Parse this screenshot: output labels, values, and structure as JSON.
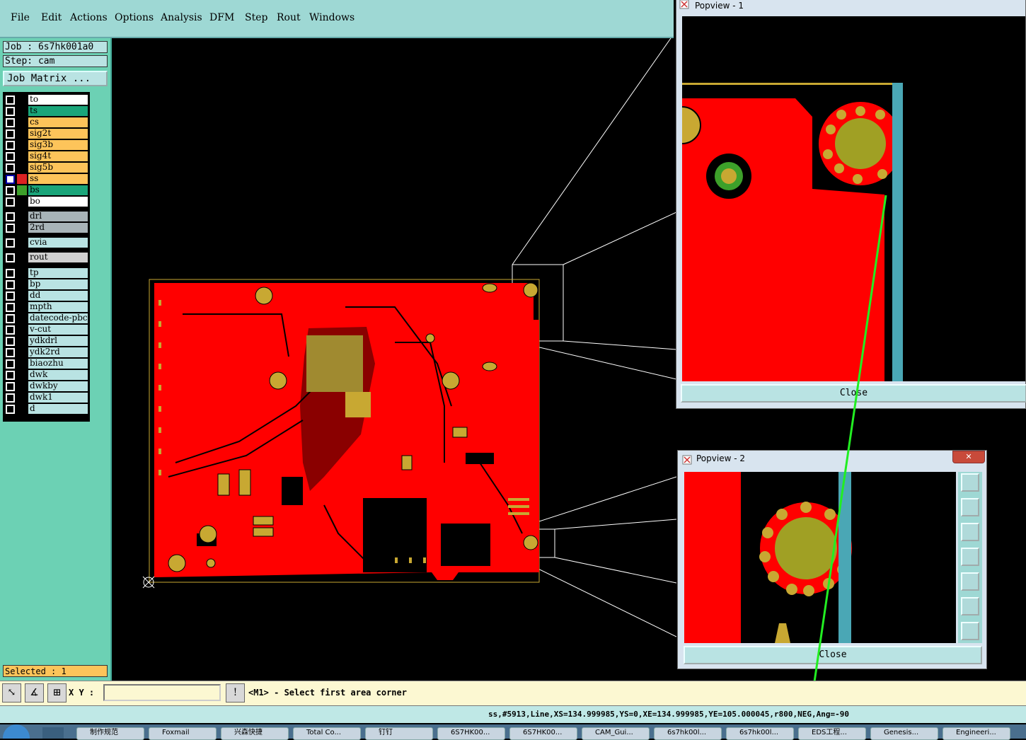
{
  "menu": [
    "File",
    "Edit",
    "Actions",
    "Options",
    "Analysis",
    "DFM",
    "Step",
    "Rout",
    "Windows"
  ],
  "job": {
    "job_line": "Job : 6s7hk001a0",
    "step_line": "Step: cam",
    "matrix_button": "Job Matrix ..."
  },
  "layers_group1": [
    {
      "name": "to",
      "bg": "#ffffff"
    },
    {
      "name": "ts",
      "bg": "#1aa57a"
    },
    {
      "name": "cs",
      "bg": "#fdc45a"
    },
    {
      "name": "sig2t",
      "bg": "#fdc45a"
    },
    {
      "name": "sig3b",
      "bg": "#fdc45a"
    },
    {
      "name": "sig4t",
      "bg": "#fdc45a"
    },
    {
      "name": "sig5b",
      "bg": "#fdc45a"
    },
    {
      "name": "ss",
      "bg": "#fdc45a"
    },
    {
      "name": "bs",
      "bg": "#1aa57a"
    },
    {
      "name": "bo",
      "bg": "#ffffff"
    }
  ],
  "layers_group2": [
    {
      "name": "drl",
      "bg": "#a8b4b8"
    },
    {
      "name": "2rd",
      "bg": "#a8b4b8"
    }
  ],
  "layers_group3": [
    {
      "name": "cvia",
      "bg": "#b9e3e3"
    }
  ],
  "layers_group4": [
    {
      "name": "rout",
      "bg": "#d0d0d0"
    }
  ],
  "layers_group5": [
    {
      "name": "tp",
      "bg": "#b9e3e3"
    },
    {
      "name": "bp",
      "bg": "#b9e3e3"
    },
    {
      "name": "dd",
      "bg": "#b9e3e3"
    },
    {
      "name": "mpth",
      "bg": "#b9e3e3"
    },
    {
      "name": "datecode-pbc",
      "bg": "#b9e3e3"
    },
    {
      "name": "v-cut",
      "bg": "#b9e3e3"
    },
    {
      "name": "ydkdrl",
      "bg": "#b9e3e3"
    },
    {
      "name": "ydk2rd",
      "bg": "#b9e3e3"
    },
    {
      "name": "biaozhu",
      "bg": "#b9e3e3"
    },
    {
      "name": "dwk",
      "bg": "#b9e3e3"
    },
    {
      "name": "dwkby",
      "bg": "#b9e3e3"
    },
    {
      "name": "dwk1",
      "bg": "#b9e3e3"
    },
    {
      "name": "d",
      "bg": "#b9e3e3"
    }
  ],
  "selected": "Selected : 1",
  "xy_label": "X Y :",
  "xy_value": "",
  "prompt": "<M1> - Select first area corner",
  "status": "ss,#5913,Line,XS=134.999985,YS=0,XE=134.999985,YE=105.000045,r800,NEG,Ang=-90",
  "popview1": {
    "title": "Popview - 1",
    "close": "Close"
  },
  "popview2": {
    "title": "Popview - 2",
    "close": "Close"
  },
  "taskbar": [
    "制作规范",
    "Foxmail",
    "兴森快捷",
    "Total Co...",
    "钉钉",
    "6S7HK00...",
    "6S7HK00...",
    "CAM_Gui...",
    "6s7hk00l...",
    "6s7hk00l...",
    "EDS工程...",
    "Genesis...",
    "Engineeri..."
  ],
  "colors": {
    "copper": "#ff0000",
    "pad": "#c8a832",
    "accent_panel": "#6cd1b4",
    "annotation_arrow": "#22ee22"
  }
}
